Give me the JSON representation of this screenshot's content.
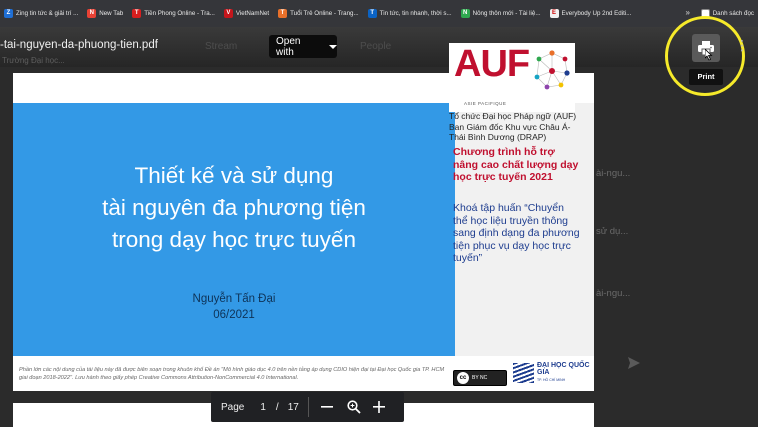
{
  "bookmarks": {
    "items": [
      {
        "label": "Zing tin tức & giải trí ...",
        "color": "#1f6fd6",
        "glyph": "Z"
      },
      {
        "label": "New Tab",
        "color": "#e94235",
        "glyph": "N"
      },
      {
        "label": "Tiền Phong Online - Tra...",
        "color": "#d81e1e",
        "glyph": "T"
      },
      {
        "label": "VietNamNet",
        "color": "#c4161c",
        "glyph": "V"
      },
      {
        "label": "Tuổi Trẻ Online - Trang...",
        "color": "#e8702a",
        "glyph": "T"
      },
      {
        "label": "Tin tức, tin nhanh, thời s...",
        "color": "#0b63c4",
        "glyph": "T"
      },
      {
        "label": "Nông thôn mới - Tài liệ...",
        "color": "#2fa84f",
        "glyph": "N"
      },
      {
        "label": "Everybody Up 2nd Editi...",
        "color": "#f0f0f0",
        "glyph": "E"
      }
    ],
    "more": "»",
    "reading_list": "Danh sách đọc"
  },
  "viewer": {
    "filename": "-tai-nguyen-da-phuong-tien.pdf",
    "under_filename": "Trường Đại học...",
    "stream_tab": "Stream",
    "people_tab": "People",
    "open_with": "Open with",
    "print_tooltip": "Print",
    "highlight_color": "#f6ea2a"
  },
  "background_page": {
    "snippets": [
      "ài-ngu...",
      "sử dụ...",
      "ài-ngu..."
    ]
  },
  "slide": {
    "title_lines": [
      "Thiết kế và sử dụng",
      "tài nguyên đa phương tiện",
      "trong dạy học trực tuyến"
    ],
    "author": "Nguyễn Tấn Đại",
    "date": "06/2021",
    "auf_logo": "AUF",
    "auf_sub": "ASIE PACIFIQUE",
    "org_text": "Tổ chức Đại học Pháp ngữ (AUF) Ban Giám đốc Khu vực Châu Á-Thái Bình Dương (DRAP)",
    "program_text": "Chương trình hỗ trợ nâng cao chất lượng dạy học trực tuyến 2021",
    "course_text": "Khoá tập huấn “Chuyển thể học liệu truyền thông sang định dạng đa phương tiện phục vụ dạy học trực tuyến”",
    "footnote": "Phần lớn các nội dung của tài liệu này đã được biên soạn trong khuôn khổ Đề án \"Mô hình giáo dục 4.0 trên nền tảng áp dụng CDIO hiện đại tại Đại học Quốc gia TP. HCM giai đoạn 2018-2022\". Lưu hành theo giấy phép Creative Commons Attribution-NonCommercial 4.0 International.",
    "cc_label": "cc",
    "cc_by": "BY NC",
    "dhqg_name": "ĐẠI HỌC QUỐC GIA",
    "dhqg_sub": "TP. HỒ CHÍ MINH",
    "slide_blue": "#3399e6",
    "accent_red": "#c0102f",
    "accent_navy": "#1e3d8f"
  },
  "pagination": {
    "label": "Page",
    "current": "1",
    "separator": "/",
    "total": "17"
  }
}
